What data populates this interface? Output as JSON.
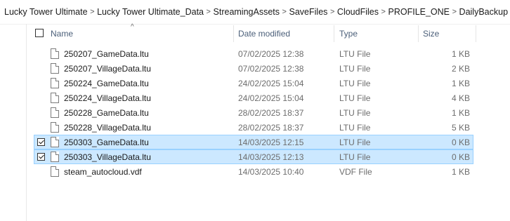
{
  "breadcrumb": [
    "Lucky Tower Ultimate",
    "Lucky Tower Ultimate_Data",
    "StreamingAssets",
    "SaveFiles",
    "CloudFiles",
    "PROFILE_ONE",
    "DailyBackup"
  ],
  "breadcrumb_separator": ">",
  "columns": {
    "name": "Name",
    "date": "Date modified",
    "type": "Type",
    "size": "Size"
  },
  "sort_indicator": "^",
  "files": [
    {
      "name": "250207_GameData.ltu",
      "date": "07/02/2025 12:38",
      "type": "LTU File",
      "size": "1 KB",
      "selected": false
    },
    {
      "name": "250207_VillageData.ltu",
      "date": "07/02/2025 12:38",
      "type": "LTU File",
      "size": "2 KB",
      "selected": false
    },
    {
      "name": "250224_GameData.ltu",
      "date": "24/02/2025 15:04",
      "type": "LTU File",
      "size": "1 KB",
      "selected": false
    },
    {
      "name": "250224_VillageData.ltu",
      "date": "24/02/2025 15:04",
      "type": "LTU File",
      "size": "4 KB",
      "selected": false
    },
    {
      "name": "250228_GameData.ltu",
      "date": "28/02/2025 18:37",
      "type": "LTU File",
      "size": "1 KB",
      "selected": false
    },
    {
      "name": "250228_VillageData.ltu",
      "date": "28/02/2025 18:37",
      "type": "LTU File",
      "size": "5 KB",
      "selected": false
    },
    {
      "name": "250303_GameData.ltu",
      "date": "14/03/2025 12:15",
      "type": "LTU File",
      "size": "0 KB",
      "selected": true
    },
    {
      "name": "250303_VillageData.ltu",
      "date": "14/03/2025 12:13",
      "type": "LTU File",
      "size": "0 KB",
      "selected": true
    },
    {
      "name": "steam_autocloud.vdf",
      "date": "14/03/2025 10:40",
      "type": "VDF File",
      "size": "1 KB",
      "selected": false
    }
  ],
  "colors": {
    "selection_bg": "#cce8ff",
    "selection_border": "#99d1ff",
    "header_text": "#4c607a"
  },
  "icons": {
    "file": "file-icon",
    "checkbox": "checkbox-icon"
  }
}
